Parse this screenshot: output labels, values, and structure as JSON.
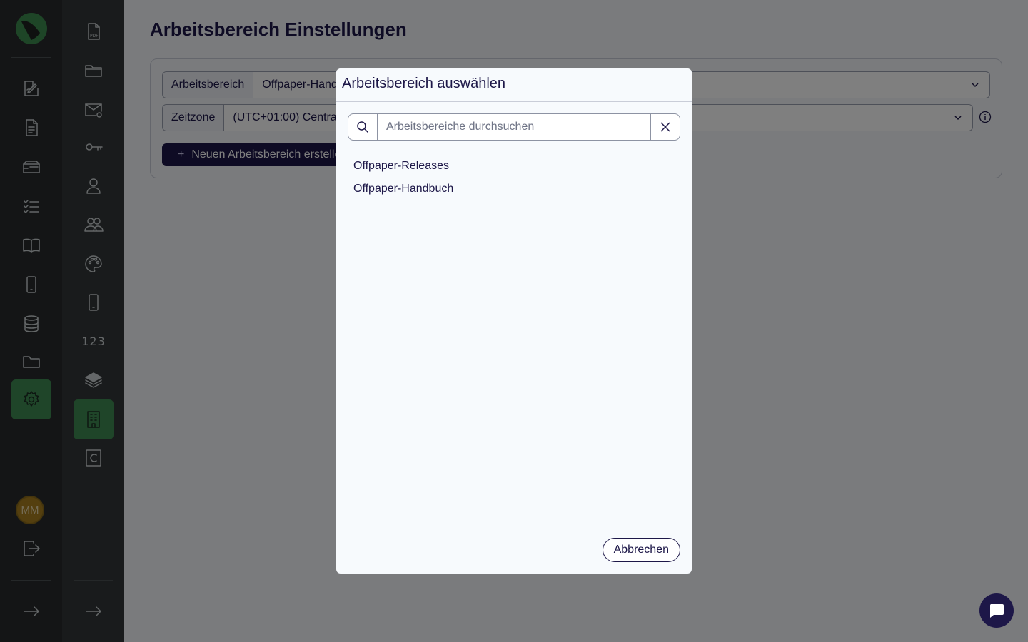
{
  "page": {
    "title": "Arbeitsbereich Einstellungen",
    "workspace_label": "Arbeitsbereich",
    "workspace_value": "Offpaper-Handbuch",
    "timezone_label": "Zeitzone",
    "timezone_value": "(UTC+01:00) Central European Time",
    "new_workspace_label": "Neuen Arbeitsbereich erstellen"
  },
  "rail2": {
    "counter_label": "123"
  },
  "user": {
    "initials": "MM"
  },
  "modal": {
    "title": "Arbeitsbereich auswählen",
    "search_placeholder": "Arbeitsbereiche durchsuchen",
    "items": [
      "Offpaper-Releases",
      "Offpaper-Handbuch"
    ],
    "cancel_label": "Abbrechen"
  },
  "colors": {
    "accent_green": "#3f8a52",
    "primary_navy": "#1d1748",
    "rail_dark": "#282b2c"
  }
}
